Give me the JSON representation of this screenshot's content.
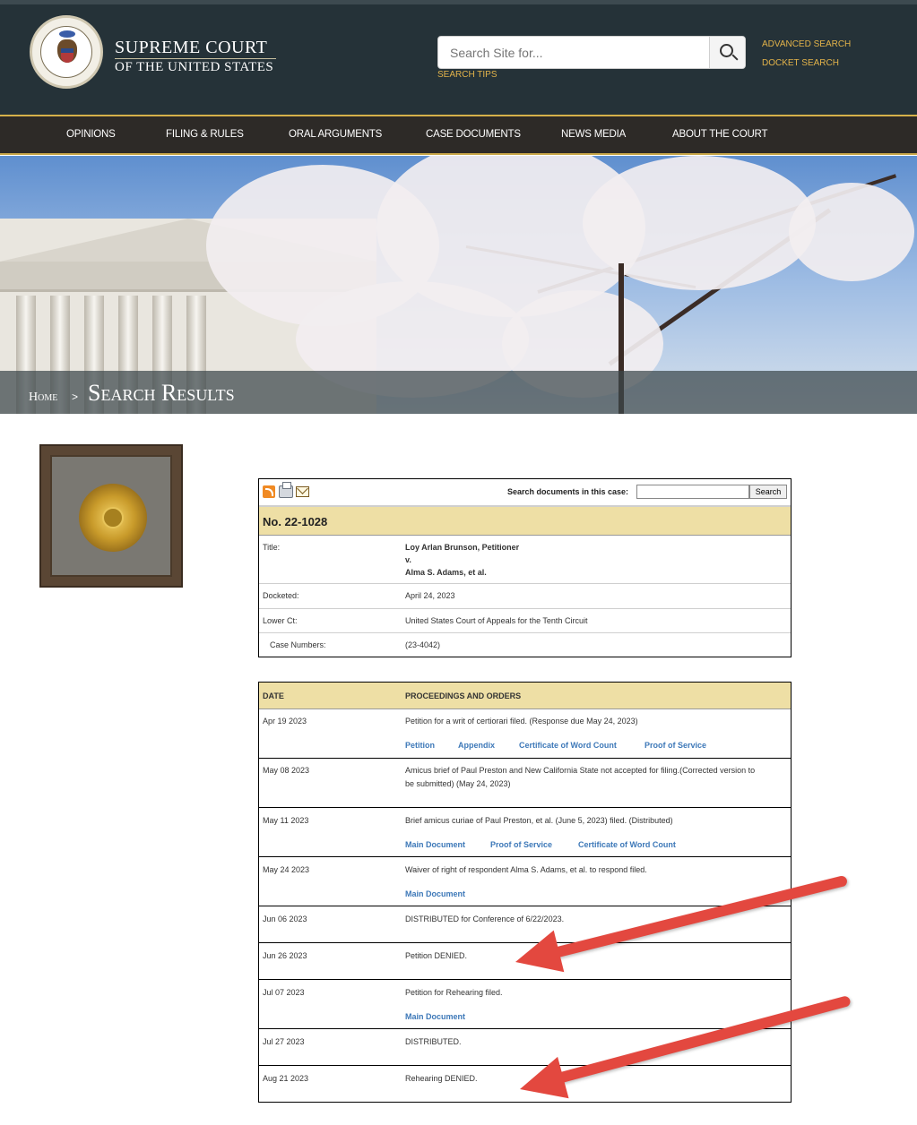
{
  "header": {
    "title": "SUPREME COURT",
    "subtitle": "OF THE UNITED STATES",
    "search_placeholder": "Search Site for...",
    "search_tips": "SEARCH TIPS",
    "advanced_search": "ADVANCED SEARCH",
    "docket_search": "DOCKET SEARCH"
  },
  "nav": [
    {
      "label": "OPINIONS"
    },
    {
      "label": "FILING & RULES"
    },
    {
      "label": "ORAL ARGUMENTS"
    },
    {
      "label": "CASE DOCUMENTS"
    },
    {
      "label": "NEWS MEDIA"
    },
    {
      "label": "ABOUT THE COURT"
    }
  ],
  "breadcrumb": {
    "home": "Home",
    "separator": ">",
    "current": "Search Results"
  },
  "case": {
    "doc_search_label": "Search documents in this case:",
    "doc_search_button": "Search",
    "number": "No. 22-1028",
    "fields": [
      {
        "label": "Title:",
        "value_lines": [
          "Loy Arlan Brunson, Petitioner",
          "v.",
          "Alma S. Adams, et al."
        ]
      },
      {
        "label": "Docketed:",
        "value": "April 24, 2023"
      },
      {
        "label": "Lower Ct:",
        "value": "United States Court of Appeals for the Tenth Circuit"
      },
      {
        "label": "Case Numbers:",
        "value": "(23-4042)"
      }
    ]
  },
  "proceedings": {
    "header_date": "DATE",
    "header_proceedings": "PROCEEDINGS AND ORDERS",
    "rows": [
      {
        "date": "Apr 19 2023",
        "text": "Petition for a writ of certiorari filed. (Response due May 24, 2023)",
        "links": [
          "Petition",
          "Appendix",
          "Certificate of Word Count",
          "Proof of Service"
        ]
      },
      {
        "date": "May 08 2023",
        "text_lines": [
          "Amicus brief of Paul Preston and New California State not accepted for filing.(Corrected version to",
          "be submitted) (May 24, 2023)"
        ]
      },
      {
        "date": "May 11 2023",
        "text": "Brief amicus curiae of Paul Preston, et al. (June 5, 2023) filed. (Distributed)",
        "links": [
          "Main Document",
          "Proof of Service",
          "Certificate of Word Count"
        ]
      },
      {
        "date": "May 24 2023",
        "text": "Waiver of right of respondent Alma S. Adams, et al. to respond filed.",
        "links": [
          "Main Document"
        ]
      },
      {
        "date": "Jun 06 2023",
        "text": "DISTRIBUTED for Conference of 6/22/2023."
      },
      {
        "date": "Jun 26 2023",
        "text": "Petition DENIED."
      },
      {
        "date": "Jul 07 2023",
        "text": "Petition for Rehearing filed.",
        "links": [
          "Main Document"
        ]
      },
      {
        "date": "Jul 27 2023",
        "text": "DISTRIBUTED."
      },
      {
        "date": "Aug 21 2023",
        "text": "Rehearing DENIED."
      }
    ]
  },
  "colors": {
    "header_bg": "#253238",
    "gold_accent": "#e2b34a",
    "table_header_bg": "#eedfa5",
    "link_blue": "#3d78b8",
    "annotation_arrow": "#e3483f"
  }
}
